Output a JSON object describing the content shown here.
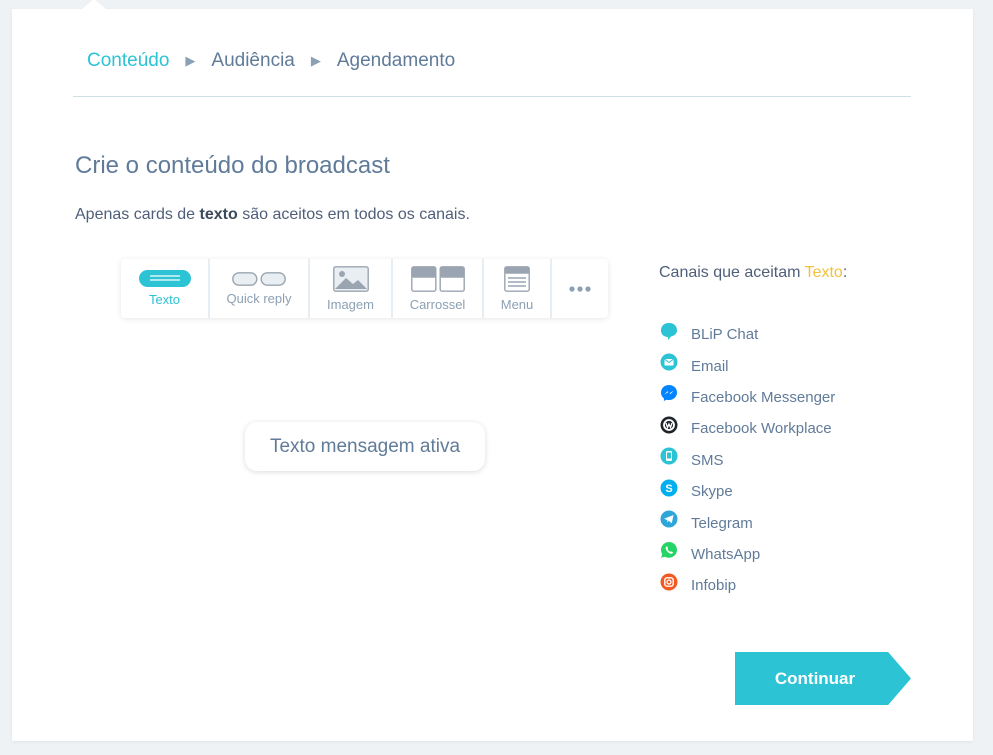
{
  "breadcrumb": {
    "steps": [
      "Conteúdo",
      "Audiência",
      "Agendamento"
    ],
    "separator": "▶"
  },
  "content": {
    "title": "Crie o conteúdo do broadcast",
    "subtitle_pre": "Apenas cards de ",
    "subtitle_bold": "texto",
    "subtitle_post": " são aceitos em todos os canais."
  },
  "card_types": [
    {
      "label": "Texto",
      "icon": "text-card-icon",
      "active": true
    },
    {
      "label": "Quick reply",
      "icon": "quick-reply-icon",
      "active": false
    },
    {
      "label": "Imagem",
      "icon": "image-icon",
      "active": false
    },
    {
      "label": "Carrossel",
      "icon": "carousel-icon",
      "active": false
    },
    {
      "label": "Menu",
      "icon": "menu-icon",
      "active": false
    },
    {
      "label": "",
      "icon": "more-icon",
      "active": false
    }
  ],
  "preview": {
    "message": "Texto mensagem ativa"
  },
  "channels": {
    "heading_pre": "Canais que aceitam ",
    "heading_highlight": "Texto",
    "heading_post": ":",
    "items": [
      {
        "name": "BLiP Chat",
        "icon": "blip-chat-icon",
        "color": "#2cc3d5"
      },
      {
        "name": "Email",
        "icon": "email-icon",
        "color": "#2cc3d5"
      },
      {
        "name": "Facebook Messenger",
        "icon": "messenger-icon",
        "color": "#0084ff"
      },
      {
        "name": "Facebook Workplace",
        "icon": "workplace-icon",
        "color": "#20252b"
      },
      {
        "name": "SMS",
        "icon": "sms-icon",
        "color": "#2cc3d5"
      },
      {
        "name": "Skype",
        "icon": "skype-icon",
        "color": "#00aff0"
      },
      {
        "name": "Telegram",
        "icon": "telegram-icon",
        "color": "#2ea6d9"
      },
      {
        "name": "WhatsApp",
        "icon": "whatsapp-icon",
        "color": "#25d366"
      },
      {
        "name": "Infobip",
        "icon": "infobip-icon",
        "color": "#f15a22"
      }
    ]
  },
  "actions": {
    "continue_label": "Continuar"
  },
  "colors": {
    "accent": "#2cc3d5",
    "highlight": "#f5bf3a",
    "text": "#607b99"
  }
}
